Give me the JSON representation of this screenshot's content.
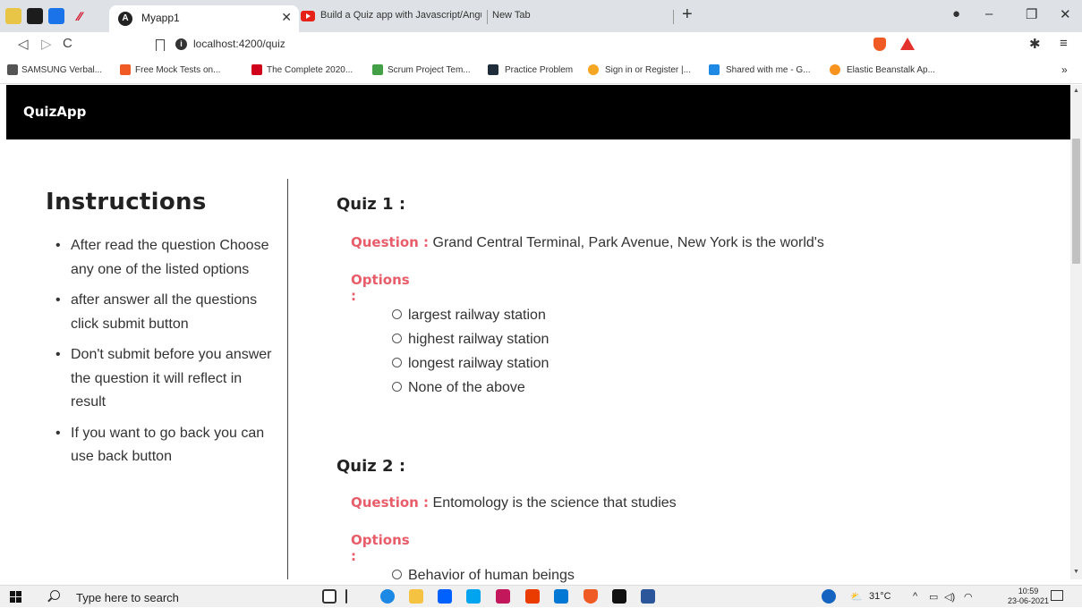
{
  "browser": {
    "active_tab": {
      "title": "Myapp1",
      "favicon": "angular-icon"
    },
    "tabs": [
      {
        "title": "Build a Quiz app with Javascript/Angu",
        "favicon": "youtube-icon"
      },
      {
        "title": "New Tab"
      }
    ],
    "url": "localhost:4200/quiz",
    "bookmarks": [
      {
        "label": "SAMSUNG Verbal...",
        "color": "#555555"
      },
      {
        "label": "Free Mock Tests on...",
        "color": "#f05a24"
      },
      {
        "label": "The Complete 2020...",
        "color": "#d0021b"
      },
      {
        "label": "Scrum Project Tem...",
        "color": "#43a047"
      },
      {
        "label": "Practice Problem",
        "color": "#1f2c3a"
      },
      {
        "label": "Sign in or Register |...",
        "color": "#f5a623"
      },
      {
        "label": "Shared with me - G...",
        "color": "#1e88e5"
      },
      {
        "label": "Elastic Beanstalk Ap...",
        "color": "#f7931e"
      }
    ]
  },
  "app": {
    "brand": "QuizApp",
    "colors": {
      "navbar": "#000000",
      "accent": "#e85d6a"
    }
  },
  "instructions": {
    "title": "Instructions",
    "items": [
      "After read the question Choose any one of the listed options",
      "after answer all the questions click submit button",
      "Don't submit before you answer the question it will reflect in result",
      "If you want to go back you can use back button"
    ]
  },
  "quizzes": [
    {
      "title": "Quiz 1 :",
      "question_label": "Question :",
      "question": "Grand Central Terminal, Park Avenue, New York is the world's",
      "options_label": "Options :",
      "options": [
        "largest railway station",
        "highest railway station",
        "longest railway station",
        "None of the above"
      ]
    },
    {
      "title": "Quiz 2 :",
      "question_label": "Question :",
      "question": "Entomology is the science that studies",
      "options_label": "Options :",
      "options": [
        "Behavior of human beings"
      ]
    }
  ],
  "taskbar": {
    "search_placeholder": "Type here to search",
    "weather": "31°C",
    "time": "10:59",
    "date": "23-06-2021"
  }
}
